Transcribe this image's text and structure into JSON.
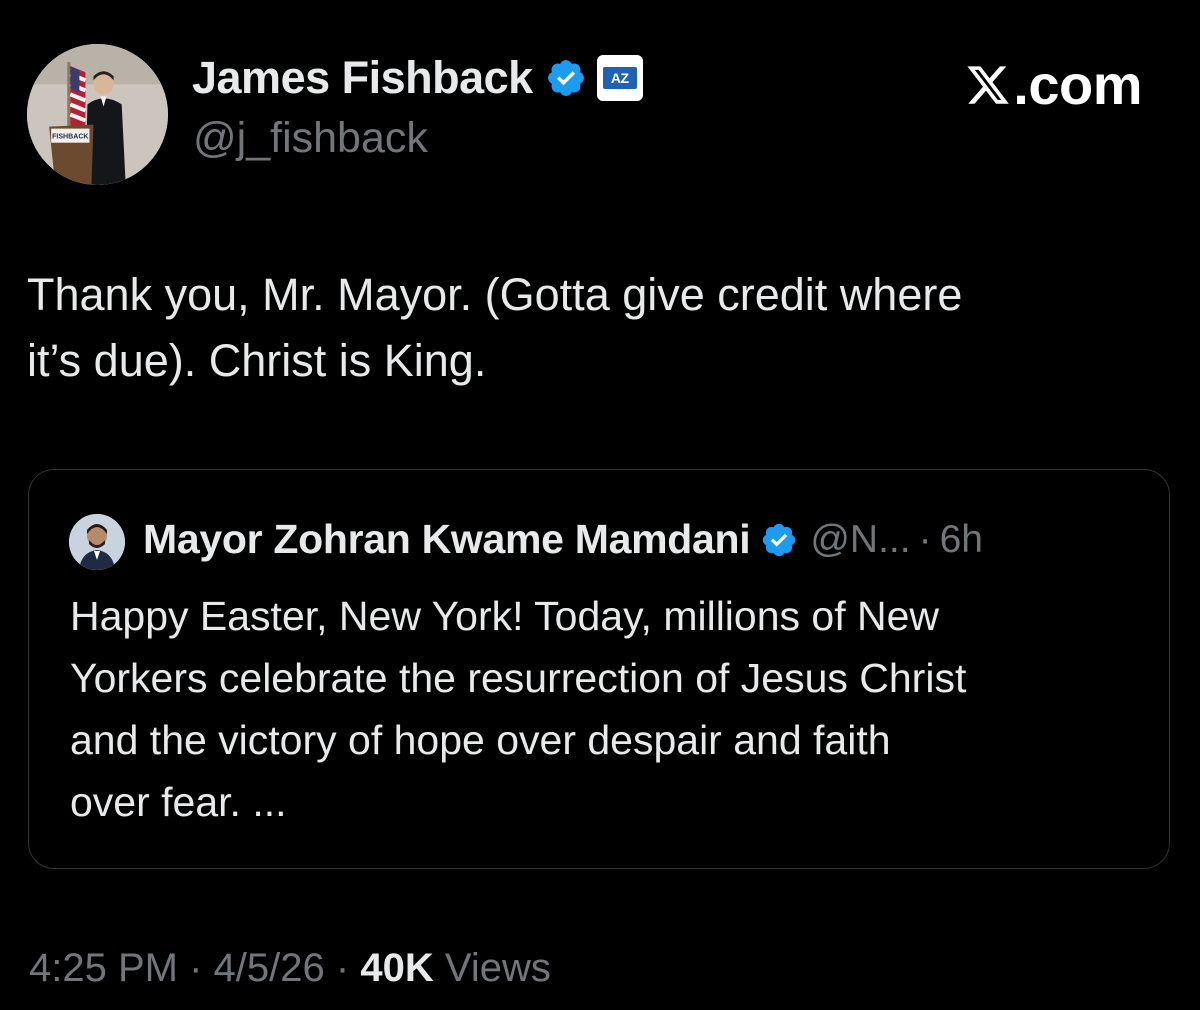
{
  "author": {
    "name": "James Fishback",
    "handle": "@j_fishback",
    "affiliate_badge": "AZ",
    "podium_sign": "FISHBACK"
  },
  "brand": {
    "site_text": ".com"
  },
  "tweet": {
    "text_line1": "Thank you, Mr. Mayor. (Gotta give credit where",
    "text_line2": "it’s due). Christ is King."
  },
  "quote": {
    "name": "Mayor Zohran Kwame Mamdani",
    "handle": "@N...",
    "separator": "·",
    "time": "6h",
    "text_line1": "Happy Easter, New York! Today, millions of New",
    "text_line2": "Yorkers celebrate the resurrection of Jesus Christ",
    "text_line3": "and the victory of hope over despair and faith",
    "text_line4": "over fear. ..."
  },
  "meta": {
    "time": "4:25 PM",
    "sep1": "·",
    "date": "4/5/26",
    "sep2": "·",
    "views_count": "40K",
    "views_label": "Views"
  },
  "colors": {
    "background": "#000000",
    "primary_text": "#e7e9ea",
    "secondary_text": "#71767b",
    "verified_blue": "#1d9bf0",
    "border": "#2f3336"
  },
  "icons": [
    "verified-badge-icon",
    "affiliate-badge-icon",
    "x-logo-icon"
  ]
}
